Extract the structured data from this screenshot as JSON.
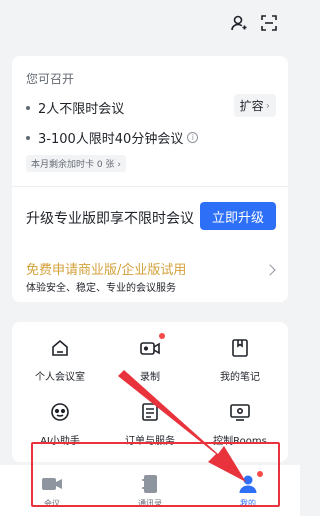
{
  "colors": {
    "accent": "#2d6ff7",
    "promo": "#d4a13b",
    "badge": "#f54a45",
    "annotation": "#e8323c"
  },
  "topbar": {
    "icons": [
      "contact-icon",
      "scan-icon"
    ]
  },
  "account_card": {
    "heading": "您可召开",
    "items": [
      {
        "text": "2人不限时会议"
      },
      {
        "text": "3-100人限时40分钟会议",
        "icon": "info-icon"
      }
    ],
    "expand_label": "扩容",
    "addon_card_label": "本月剩余加时卡 0 张",
    "upgrade_text": "升级专业版即享不限时会议",
    "upgrade_button": "立即升级"
  },
  "promo": {
    "title": "免费申请商业版/企业版试用",
    "subtitle": "体验安全、稳定、专业的会议服务"
  },
  "grid": [
    {
      "label": "个人会议室",
      "icon": "home-icon",
      "badge": false
    },
    {
      "label": "录制",
      "icon": "video-record-icon",
      "badge": true
    },
    {
      "label": "我的笔记",
      "icon": "notes-icon",
      "badge": false
    },
    {
      "label": "AI小助手",
      "icon": "ai-assistant-icon",
      "badge": false
    },
    {
      "label": "订单与服务",
      "icon": "order-icon",
      "badge": false
    },
    {
      "label": "控制Rooms",
      "icon": "rooms-icon",
      "badge": false
    }
  ],
  "bottom_nav": [
    {
      "label": "会议",
      "icon": "meeting-icon",
      "active": false
    },
    {
      "label": "通讯录",
      "icon": "contacts-book-icon",
      "active": false
    },
    {
      "label": "我的",
      "icon": "profile-icon",
      "active": true
    }
  ]
}
